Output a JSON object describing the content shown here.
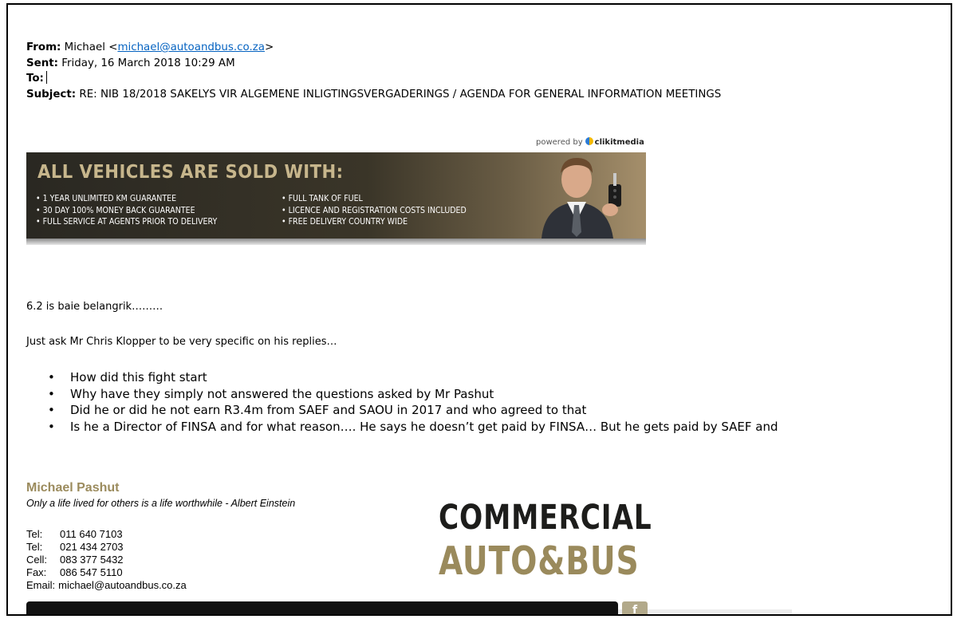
{
  "email": {
    "from_label": "From:",
    "from_name": "Michael <",
    "from_address": "michael@autoandbus.co.za",
    "from_close": ">",
    "sent_label": "Sent:",
    "sent_value": "Friday, 16 March 2018 10:29 AM",
    "to_label": "To:",
    "subject_label": "Subject:",
    "subject_value": "RE: NIB 18/2018 SAKELYS VIR ALGEMENE INLIGTINGSVERGADERINGS / AGENDA FOR GENERAL INFORMATION MEETINGS"
  },
  "ad": {
    "powered_prefix": "powered by",
    "powered_brand": "clikitmedia",
    "title": "ALL VEHICLES ARE SOLD WITH:",
    "col1": [
      "• 1 YEAR UNLIMITED KM GUARANTEE",
      "• 30 DAY 100% MONEY BACK GUARANTEE",
      "• FULL SERVICE AT AGENTS PRIOR TO DELIVERY"
    ],
    "col2": [
      "• FULL TANK OF FUEL",
      "• LICENCE AND REGISTRATION COSTS INCLUDED",
      "• FREE DELIVERY COUNTRY WIDE"
    ]
  },
  "body": {
    "line1": "6.2 is baie belangrik………",
    "line2": "Just ask Mr Chris Klopper to be very specific on his replies…",
    "bullets": [
      "How did this fight start",
      "Why have they simply not answered the questions asked by Mr Pashut",
      "Did he or did he not earn R3.4m from SAEF and SAOU in 2017 and who agreed to that",
      "Is he a Director of FINSA and for what reason…. He says he doesn’t get paid by FINSA… But he gets paid by SAEF and"
    ]
  },
  "signature": {
    "name": "Michael Pashut",
    "quote": "Only a life lived for others is a life worthwhile - Albert Einstein",
    "contacts": [
      {
        "label": "Tel:",
        "value": "011 640 7103"
      },
      {
        "label": "Tel:",
        "value": "021 434 2703"
      },
      {
        "label": "Cell:",
        "value": "083 377 5432"
      },
      {
        "label": "Fax:",
        "value": "086 547 5110"
      }
    ],
    "email_label": "Email:",
    "email_value": "michael@autoandbus.co.za"
  },
  "logo": {
    "line1": "COMMERCIAL",
    "line2": "AUTO&BUS",
    "social_letter": "f"
  },
  "colors": {
    "link": "#0563c1",
    "brand_gold": "#9a8a5c",
    "banner_dark": "#2a2822"
  }
}
